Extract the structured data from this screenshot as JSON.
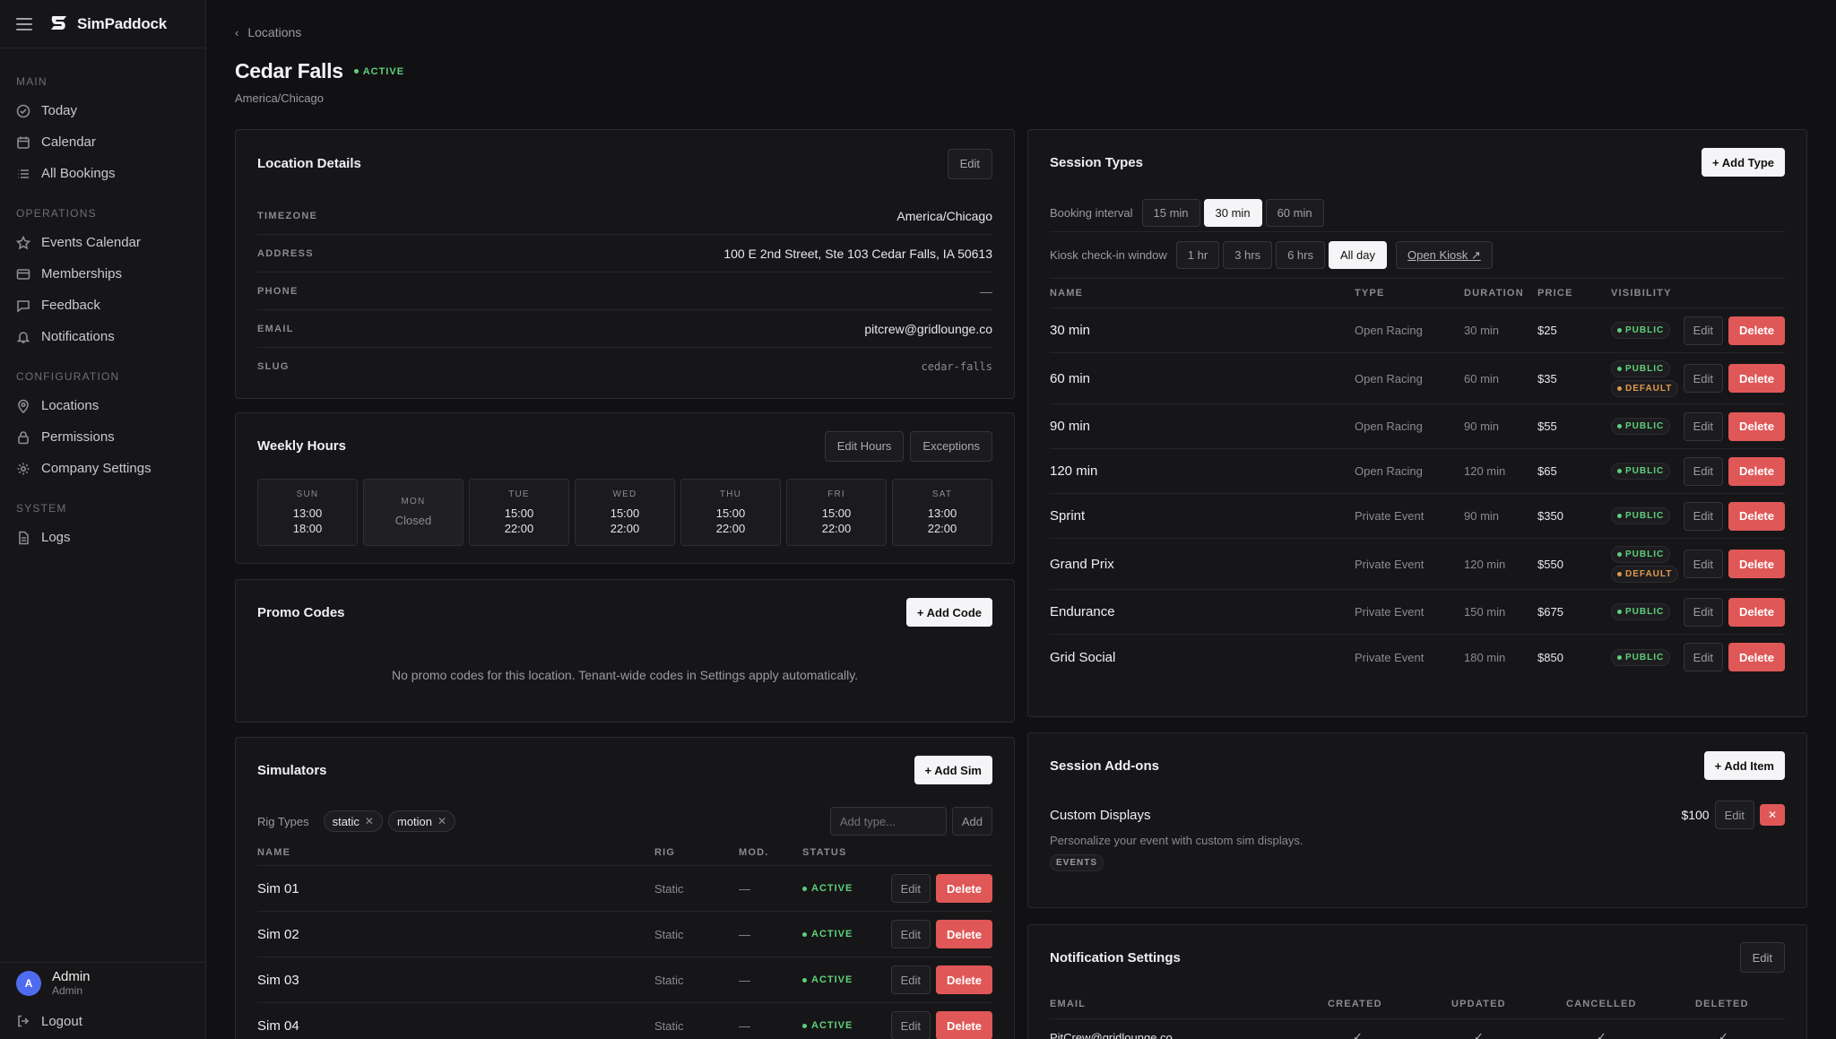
{
  "brand": {
    "name": "SimPaddock"
  },
  "sidebar": {
    "sections": [
      {
        "label": "MAIN",
        "items": [
          {
            "label": "Today"
          },
          {
            "label": "Calendar"
          },
          {
            "label": "All Bookings"
          }
        ]
      },
      {
        "label": "OPERATIONS",
        "items": [
          {
            "label": "Events Calendar"
          },
          {
            "label": "Memberships"
          },
          {
            "label": "Feedback"
          },
          {
            "label": "Notifications"
          }
        ]
      },
      {
        "label": "CONFIGURATION",
        "items": [
          {
            "label": "Locations"
          },
          {
            "label": "Permissions"
          },
          {
            "label": "Company Settings"
          }
        ]
      },
      {
        "label": "SYSTEM",
        "items": [
          {
            "label": "Logs"
          }
        ]
      }
    ],
    "user": {
      "initial": "A",
      "name": "Admin",
      "role": "Admin"
    },
    "logout": "Logout"
  },
  "breadcrumb": "Locations",
  "page": {
    "title": "Cedar Falls",
    "status": "ACTIVE",
    "subtitle": "America/Chicago"
  },
  "details": {
    "title": "Location Details",
    "edit": "Edit",
    "rows": [
      {
        "key": "TIMEZONE",
        "value": "America/Chicago"
      },
      {
        "key": "ADDRESS",
        "value": "100 E 2nd Street, Ste 103 Cedar Falls, IA 50613"
      },
      {
        "key": "PHONE",
        "value": "—"
      },
      {
        "key": "EMAIL",
        "value": "pitcrew@gridlounge.co"
      },
      {
        "key": "SLUG",
        "value": "cedar-falls"
      }
    ]
  },
  "hours": {
    "title": "Weekly Hours",
    "edit": "Edit Hours",
    "exceptions": "Exceptions",
    "days": [
      {
        "day": "SUN",
        "open": "13:00",
        "close": "18:00"
      },
      {
        "day": "MON",
        "open": "Closed",
        "close": ""
      },
      {
        "day": "TUE",
        "open": "15:00",
        "close": "22:00"
      },
      {
        "day": "WED",
        "open": "15:00",
        "close": "22:00"
      },
      {
        "day": "THU",
        "open": "15:00",
        "close": "22:00"
      },
      {
        "day": "FRI",
        "open": "15:00",
        "close": "22:00"
      },
      {
        "day": "SAT",
        "open": "13:00",
        "close": "22:00"
      }
    ]
  },
  "promo": {
    "title": "Promo Codes",
    "add": "+ Add Code",
    "empty": "No promo codes for this location. Tenant-wide codes in Settings apply automatically."
  },
  "sims": {
    "title": "Simulators",
    "add": "+ Add Sim",
    "rig_label": "Rig Types",
    "rigs": [
      "static",
      "motion"
    ],
    "add_placeholder": "Add type...",
    "add_btn": "Add",
    "headers": [
      "NAME",
      "RIG",
      "MOD.",
      "STATUS"
    ],
    "rows": [
      {
        "name": "Sim 01",
        "rig": "Static",
        "mod": "—",
        "status": "ACTIVE"
      },
      {
        "name": "Sim 02",
        "rig": "Static",
        "mod": "—",
        "status": "ACTIVE"
      },
      {
        "name": "Sim 03",
        "rig": "Static",
        "mod": "—",
        "status": "ACTIVE"
      },
      {
        "name": "Sim 04",
        "rig": "Static",
        "mod": "—",
        "status": "ACTIVE"
      }
    ],
    "edit": "Edit",
    "delete": "Delete"
  },
  "sessions": {
    "title": "Session Types",
    "add": "+ Add Type",
    "interval_label": "Booking interval",
    "intervals": [
      "15 min",
      "30 min",
      "60 min"
    ],
    "interval_selected": "30 min",
    "kiosk_label": "Kiosk check-in window",
    "kiosk": [
      "1 hr",
      "3 hrs",
      "6 hrs",
      "All day"
    ],
    "kiosk_selected": "All day",
    "open_kiosk": "Open Kiosk ↗",
    "headers": [
      "NAME",
      "TYPE",
      "DURATION",
      "PRICE",
      "VISIBILITY"
    ],
    "edit": "Edit",
    "delete": "Delete",
    "rows": [
      {
        "name": "30 min",
        "type": "Open Racing",
        "duration": "30 min",
        "price": "$25",
        "badges": [
          "PUBLIC"
        ]
      },
      {
        "name": "60 min",
        "type": "Open Racing",
        "duration": "60 min",
        "price": "$35",
        "badges": [
          "PUBLIC",
          "DEFAULT"
        ]
      },
      {
        "name": "90 min",
        "type": "Open Racing",
        "duration": "90 min",
        "price": "$55",
        "badges": [
          "PUBLIC"
        ]
      },
      {
        "name": "120 min",
        "type": "Open Racing",
        "duration": "120 min",
        "price": "$65",
        "badges": [
          "PUBLIC"
        ]
      },
      {
        "name": "Sprint",
        "type": "Private Event",
        "duration": "90 min",
        "price": "$350",
        "badges": [
          "PUBLIC"
        ]
      },
      {
        "name": "Grand Prix",
        "type": "Private Event",
        "duration": "120 min",
        "price": "$550",
        "badges": [
          "PUBLIC",
          "DEFAULT"
        ]
      },
      {
        "name": "Endurance",
        "type": "Private Event",
        "duration": "150 min",
        "price": "$675",
        "badges": [
          "PUBLIC"
        ]
      },
      {
        "name": "Grid Social",
        "type": "Private Event",
        "duration": "180 min",
        "price": "$850",
        "badges": [
          "PUBLIC"
        ]
      }
    ]
  },
  "addons": {
    "title": "Session Add-ons",
    "add": "+ Add Item",
    "item": {
      "name": "Custom Displays",
      "price": "$100",
      "desc": "Personalize your event with custom sim displays.",
      "tag": "EVENTS",
      "edit": "Edit",
      "remove": "✕"
    }
  },
  "notif": {
    "title": "Notification Settings",
    "edit": "Edit",
    "headers": [
      "EMAIL",
      "CREATED",
      "UPDATED",
      "CANCELLED",
      "DELETED"
    ],
    "rows": [
      {
        "email": "PitCrew@gridlounge.co",
        "marks": [
          "✓",
          "✓",
          "✓",
          "✓"
        ]
      }
    ]
  }
}
